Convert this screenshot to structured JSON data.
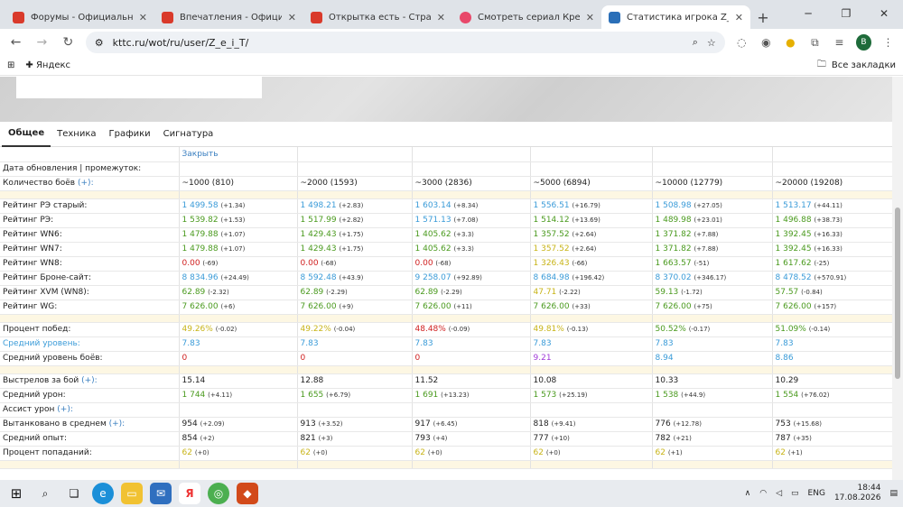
{
  "browser": {
    "tabs": [
      {
        "title": "Форумы - Официальный ф",
        "icon": "wot-icon"
      },
      {
        "title": "Впечатления - Официальн",
        "icon": "wot-icon"
      },
      {
        "title": "Открытка есть - Страница 2",
        "icon": "wot-icon"
      },
      {
        "title": "Смотреть сериал Кремнием",
        "icon": "video-icon"
      },
      {
        "title": "Статистика игрока Z_e_i_T",
        "icon": "kttc-icon"
      }
    ],
    "url": "kttc.ru/wot/ru/user/Z_e_i_T/",
    "bookmark": "Яндекс",
    "all_bookmarks": "Все закладки",
    "profile": "B"
  },
  "site_tabs": [
    "Общее",
    "Техника",
    "Графики",
    "Сигнатура"
  ],
  "close_link": "Закрыть",
  "rows": {
    "update": "Дата обновления | промежуток:",
    "battles": "Количество боёв",
    "re_old": "Рейтинг РЭ старый:",
    "re": "Рейтинг РЭ:",
    "wn6": "Рейтинг WN6:",
    "wn7": "Рейтинг WN7:",
    "wn8": "Рейтинг WN8:",
    "brone": "Рейтинг Броне-сайт:",
    "xvm": "Рейтинг XVM (WN8):",
    "wg": "Рейтинг WG:",
    "winrate": "Процент побед:",
    "avg_level": "Средний уровень:",
    "avg_level_battles": "Средний уровень боёв:",
    "shots": "Выстрелов за бой",
    "avg_dmg": "Средний урон:",
    "assist": "Ассист урон",
    "spotted": "Вытанковано в среднем",
    "avg_xp": "Средний опыт:",
    "hit_pct": "Процент попаданий:"
  },
  "plus": "(+):",
  "columns": [
    {
      "battles": "~1000 (810)",
      "re_old": [
        "1 499.58",
        "(+1.34)"
      ],
      "re": [
        "1 539.82",
        "(+1.53)"
      ],
      "wn6": [
        "1 479.88",
        "(+1.07)"
      ],
      "wn7": [
        "1 479.88",
        "(+1.07)"
      ],
      "wn8": [
        "0.00",
        "(-69)"
      ],
      "brone": [
        "8 834.96",
        "(+24.49)"
      ],
      "xvm": [
        "62.89",
        "(-2.32)"
      ],
      "wg": [
        "7 626.00",
        "(+6)"
      ],
      "winrate": [
        "49.26%",
        "(-0.02)"
      ],
      "avg_level": "7.83",
      "avg_level_battles": "0",
      "shots": "15.14",
      "avg_dmg": [
        "1 744",
        "(+4.11)"
      ],
      "spotted": [
        "954",
        "(+2.09)"
      ],
      "avg_xp": [
        "854",
        "(+2)"
      ],
      "hit_pct": [
        "62",
        "(+0)"
      ]
    },
    {
      "battles": "~2000 (1593)",
      "re_old": [
        "1 498.21",
        "(+2.83)"
      ],
      "re": [
        "1 517.99",
        "(+2.82)"
      ],
      "wn6": [
        "1 429.43",
        "(+1.75)"
      ],
      "wn7": [
        "1 429.43",
        "(+1.75)"
      ],
      "wn8": [
        "0.00",
        "(-68)"
      ],
      "brone": [
        "8 592.48",
        "(+43.9)"
      ],
      "xvm": [
        "62.89",
        "(-2.29)"
      ],
      "wg": [
        "7 626.00",
        "(+9)"
      ],
      "winrate": [
        "49.22%",
        "(-0.04)"
      ],
      "avg_level": "7.83",
      "avg_level_battles": "0",
      "shots": "12.88",
      "avg_dmg": [
        "1 655",
        "(+6.79)"
      ],
      "spotted": [
        "913",
        "(+3.52)"
      ],
      "avg_xp": [
        "821",
        "(+3)"
      ],
      "hit_pct": [
        "62",
        "(+0)"
      ]
    },
    {
      "battles": "~3000 (2836)",
      "re_old": [
        "1 603.14",
        "(+8.34)"
      ],
      "re": [
        "1 571.13",
        "(+7.08)"
      ],
      "wn6": [
        "1 405.62",
        "(+3.3)"
      ],
      "wn7": [
        "1 405.62",
        "(+3.3)"
      ],
      "wn8": [
        "0.00",
        "(-68)"
      ],
      "brone": [
        "9 258.07",
        "(+92.89)"
      ],
      "xvm": [
        "62.89",
        "(-2.29)"
      ],
      "wg": [
        "7 626.00",
        "(+11)"
      ],
      "winrate": [
        "48.48%",
        "(-0.09)"
      ],
      "avg_level": "7.83",
      "avg_level_battles": "0",
      "shots": "11.52",
      "avg_dmg": [
        "1 691",
        "(+13.23)"
      ],
      "spotted": [
        "917",
        "(+6.45)"
      ],
      "avg_xp": [
        "793",
        "(+4)"
      ],
      "hit_pct": [
        "62",
        "(+0)"
      ]
    },
    {
      "battles": "~5000 (6894)",
      "re_old": [
        "1 556.51",
        "(+16.79)"
      ],
      "re": [
        "1 514.12",
        "(+13.69)"
      ],
      "wn6": [
        "1 357.52",
        "(+2.64)"
      ],
      "wn7": [
        "1 357.52",
        "(+2.64)"
      ],
      "wn8": [
        "1 326.43",
        "(-66)"
      ],
      "brone": [
        "8 684.98",
        "(+196.42)"
      ],
      "xvm": [
        "47.71",
        "(-2.22)"
      ],
      "wg": [
        "7 626.00",
        "(+33)"
      ],
      "winrate": [
        "49.81%",
        "(-0.13)"
      ],
      "avg_level": "7.83",
      "avg_level_battles": "9.21",
      "shots": "10.08",
      "avg_dmg": [
        "1 573",
        "(+25.19)"
      ],
      "spotted": [
        "818",
        "(+9.41)"
      ],
      "avg_xp": [
        "777",
        "(+10)"
      ],
      "hit_pct": [
        "62",
        "(+0)"
      ]
    },
    {
      "battles": "~10000 (12779)",
      "re_old": [
        "1 508.98",
        "(+27.05)"
      ],
      "re": [
        "1 489.98",
        "(+23.01)"
      ],
      "wn6": [
        "1 371.82",
        "(+7.88)"
      ],
      "wn7": [
        "1 371.82",
        "(+7.88)"
      ],
      "wn8": [
        "1 663.57",
        "(-51)"
      ],
      "brone": [
        "8 370.02",
        "(+346.17)"
      ],
      "xvm": [
        "59.13",
        "(-1.72)"
      ],
      "wg": [
        "7 626.00",
        "(+75)"
      ],
      "winrate": [
        "50.52%",
        "(-0.17)"
      ],
      "avg_level": "7.83",
      "avg_level_battles": "8.94",
      "shots": "10.33",
      "avg_dmg": [
        "1 538",
        "(+44.9)"
      ],
      "spotted": [
        "776",
        "(+12.78)"
      ],
      "avg_xp": [
        "782",
        "(+21)"
      ],
      "hit_pct": [
        "62",
        "(+1)"
      ]
    },
    {
      "battles": "~20000 (19208)",
      "re_old": [
        "1 513.17",
        "(+44.11)"
      ],
      "re": [
        "1 496.88",
        "(+38.73)"
      ],
      "wn6": [
        "1 392.45",
        "(+16.33)"
      ],
      "wn7": [
        "1 392.45",
        "(+16.33)"
      ],
      "wn8": [
        "1 617.62",
        "(-25)"
      ],
      "brone": [
        "8 478.52",
        "(+570.91)"
      ],
      "xvm": [
        "57.57",
        "(-0.84)"
      ],
      "wg": [
        "7 626.00",
        "(+157)"
      ],
      "winrate": [
        "51.09%",
        "(-0.14)"
      ],
      "avg_level": "7.83",
      "avg_level_battles": "8.86",
      "shots": "10.29",
      "avg_dmg": [
        "1 554",
        "(+76.02)"
      ],
      "spotted": [
        "753",
        "(+15.68)"
      ],
      "avg_xp": [
        "787",
        "(+35)"
      ],
      "hit_pct": [
        "62",
        "(+1)"
      ]
    }
  ],
  "colors": {
    "re_old": [
      "blue",
      "blue",
      "blue",
      "blue",
      "blue",
      "blue"
    ],
    "re": [
      "green",
      "green",
      "blue",
      "green",
      "green",
      "green"
    ],
    "wn6": [
      "green",
      "green",
      "green",
      "green",
      "green",
      "green"
    ],
    "wn7": [
      "green",
      "green",
      "green",
      "yellow",
      "green",
      "green"
    ],
    "wn8": [
      "red",
      "red",
      "red",
      "yellow",
      "green",
      "green"
    ],
    "brone": [
      "blue",
      "blue",
      "blue",
      "blue",
      "blue",
      "blue"
    ],
    "xvm": [
      "green",
      "green",
      "green",
      "yellow",
      "green",
      "green"
    ],
    "wg": [
      "green",
      "green",
      "green",
      "green",
      "green",
      "green"
    ],
    "winrate": [
      "yellow",
      "yellow",
      "red",
      "yellow",
      "green",
      "green"
    ],
    "avg_level_battles": [
      "red",
      "red",
      "red",
      "purple",
      "blue",
      "blue"
    ],
    "avg_dmg": [
      "green",
      "green",
      "green",
      "green",
      "green",
      "green"
    ],
    "hit_pct": [
      "yellow",
      "yellow",
      "yellow",
      "yellow",
      "yellow",
      "yellow"
    ]
  },
  "taskbar": {
    "lang": "ENG",
    "time": "18:44",
    "date": "17.08.2026"
  }
}
